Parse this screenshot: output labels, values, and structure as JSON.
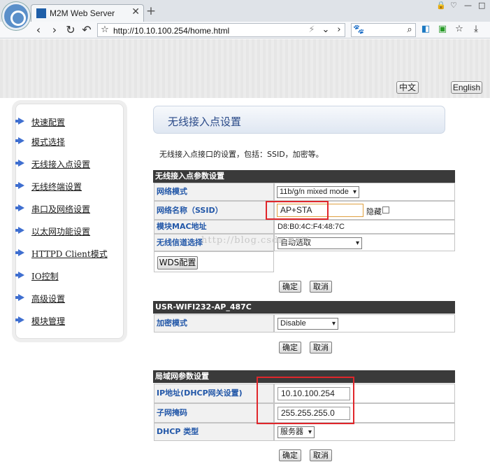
{
  "browser": {
    "tab_title": "M2M Web Server",
    "tab_close": "✕",
    "new_tab": "+",
    "url": "http://10.10.100.254/home.html"
  },
  "page": {
    "lang_buttons": [
      "中文",
      "English"
    ],
    "menu": [
      "快速配置",
      "模式选择",
      "无线接入点设置",
      "无线终端设置",
      "串口及网络设置",
      "以太网功能设置",
      "HTTPD Client模式",
      "IO控制",
      "高级设置",
      "模块管理"
    ],
    "title": "无线接入点设置",
    "description": "无线接入点接口的设置，包括：SSID，加密等。",
    "watermark": "http://blog.csdn.net/",
    "ap_section": {
      "header": "无线接入点参数设置",
      "mode_label": "网络模式",
      "mode_value": "11b/g/n mixed mode",
      "ssid_label": "网络名称（SSID）",
      "ssid_value": "AP+STA",
      "hide_label": "隐藏",
      "mac_label": "模块MAC地址",
      "mac_value": "D8:B0:4C:F4:48:7C",
      "channel_label": "无线信道选择",
      "channel_value": "自动选取",
      "wds_button": "WDS配置",
      "ok": "确定",
      "cancel": "取消"
    },
    "security_section": {
      "header": "USR-WIFI232-AP_487C",
      "enc_label": "加密模式",
      "enc_value": "Disable",
      "ok": "确定",
      "cancel": "取消"
    },
    "lan_section": {
      "header": "局域网参数设置",
      "ip_label": "IP地址(DHCP网关设置)",
      "ip_value": "10.10.100.254",
      "mask_label": "子网掩码",
      "mask_value": "255.255.255.0",
      "dhcp_label": "DHCP 类型",
      "dhcp_value": "服务器",
      "ok": "确定",
      "cancel": "取消"
    }
  },
  "colors": {
    "link_label": "#2257a8",
    "section_header": "#3a3a3a",
    "highlight": "#e0262b",
    "menu_arrow": "#3f6fd0"
  }
}
